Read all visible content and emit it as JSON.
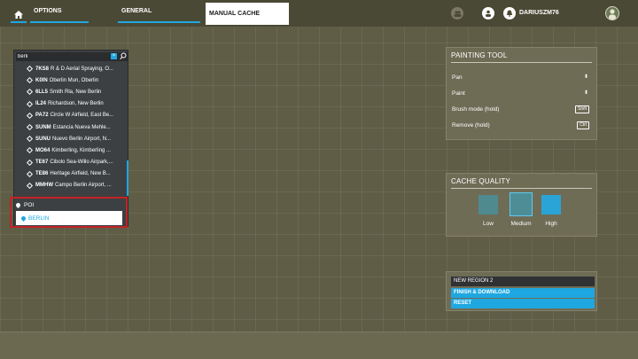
{
  "nav": {
    "tabs": [
      {
        "label": "OPTIONS"
      },
      {
        "label": "GENERAL"
      },
      {
        "label": "MANUAL CACHE"
      }
    ],
    "username": "DARIUSZM76"
  },
  "search": {
    "query": "berli",
    "clear_label": "×",
    "results": [
      {
        "code": "7KS8",
        "name": "R & D Aerial Spraying, O..."
      },
      {
        "code": "K0IN",
        "name": "Oberlin Mun, Oberlin"
      },
      {
        "code": "6LL5",
        "name": "Smith Rla, New Berlin"
      },
      {
        "code": "IL24",
        "name": "Richardson, New Berlin"
      },
      {
        "code": "PA72",
        "name": "Circle W Airfield, East Be..."
      },
      {
        "code": "SUNM",
        "name": "Estancia Nueva Mehle..."
      },
      {
        "code": "SUNU",
        "name": "Nuevo Berlin Airport, N..."
      },
      {
        "code": "MO64",
        "name": "Kimberling, Kimberling ..."
      },
      {
        "code": "TE67",
        "name": "Cibolo Sea-Willo Airpark,..."
      },
      {
        "code": "TE86",
        "name": "Heritage Airfield, New B..."
      },
      {
        "code": "MMHW",
        "name": "Campo Berlin Airport, ..."
      }
    ],
    "poi_label": "POI",
    "poi_item": "BERLIN"
  },
  "painting_tool": {
    "title": "PAINTING TOOL",
    "rows": [
      {
        "label": "Pan",
        "hint": ""
      },
      {
        "label": "Paint",
        "hint": ""
      },
      {
        "label": "Brush mode (hold)",
        "hint": "Shift"
      },
      {
        "label": "Remove (hold)",
        "hint": "Ctrl"
      }
    ]
  },
  "cache_quality": {
    "title": "CACHE QUALITY",
    "options": [
      {
        "label": "Low"
      },
      {
        "label": "Medium"
      },
      {
        "label": "High"
      }
    ],
    "selected": "Medium"
  },
  "region": {
    "name": "NEW REGION 2",
    "finish_label": "FINISH & DOWNLOAD",
    "reset_label": "RESET"
  },
  "colors": {
    "accent": "#1ea7e1",
    "highlight_border": "#c32228"
  }
}
